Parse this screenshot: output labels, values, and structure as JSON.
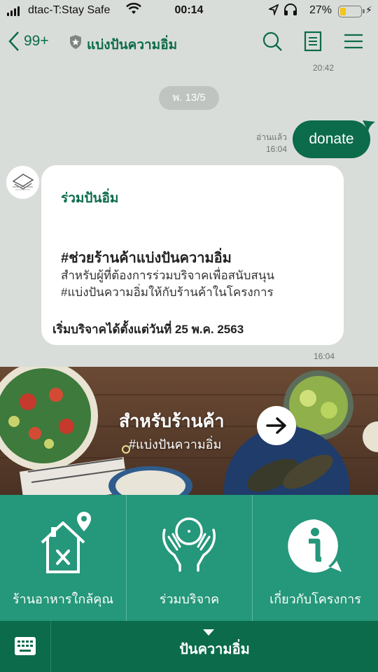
{
  "status_bar": {
    "carrier": "dtac-T:Stay Safe",
    "time": "00:14",
    "battery": "27%"
  },
  "header": {
    "back_count": "99+",
    "title": "แบ่งปันความอิ่ม"
  },
  "chat": {
    "prev_time": "20:42",
    "date_pill": "พ. 13/5",
    "outgoing": {
      "text": "donate",
      "read_label": "อ่านแล้ว",
      "time": "16:04"
    },
    "incoming_card": {
      "title": "ร่วมปันอิ่ม",
      "heading": "#ช่วยร้านค้าแบ่งปันความอิ่ม",
      "line1": "สำหรับผู้ที่ต้องการร่วมบริจาคเพื่อสนับสนุน",
      "line2": "#แบ่งปันความอิ่มให้กับร้านค้าในโครงการ",
      "footer": "เริ่มบริจาคได้ตั้งแต่วันที่ 25 พ.ค. 2563",
      "time": "16:04"
    }
  },
  "banner": {
    "title": "สำหรับร้านค้า",
    "subtitle": "#แบ่งปันความอิ่ม"
  },
  "rich_menu": {
    "items": [
      {
        "label": "ร้านอาหารใกล้คุณ",
        "icon": "house-restaurant-icon"
      },
      {
        "label": "ร่วมบริจาค",
        "icon": "donate-hands-icon"
      },
      {
        "label": "เกี่ยวกับโครงการ",
        "icon": "info-icon"
      }
    ]
  },
  "bottom_bar": {
    "label": "ปันความอิ่ม"
  },
  "colors": {
    "brand_green": "#0b6b4a",
    "menu_green": "#25977a",
    "chat_bg": "#d9ddd9"
  }
}
